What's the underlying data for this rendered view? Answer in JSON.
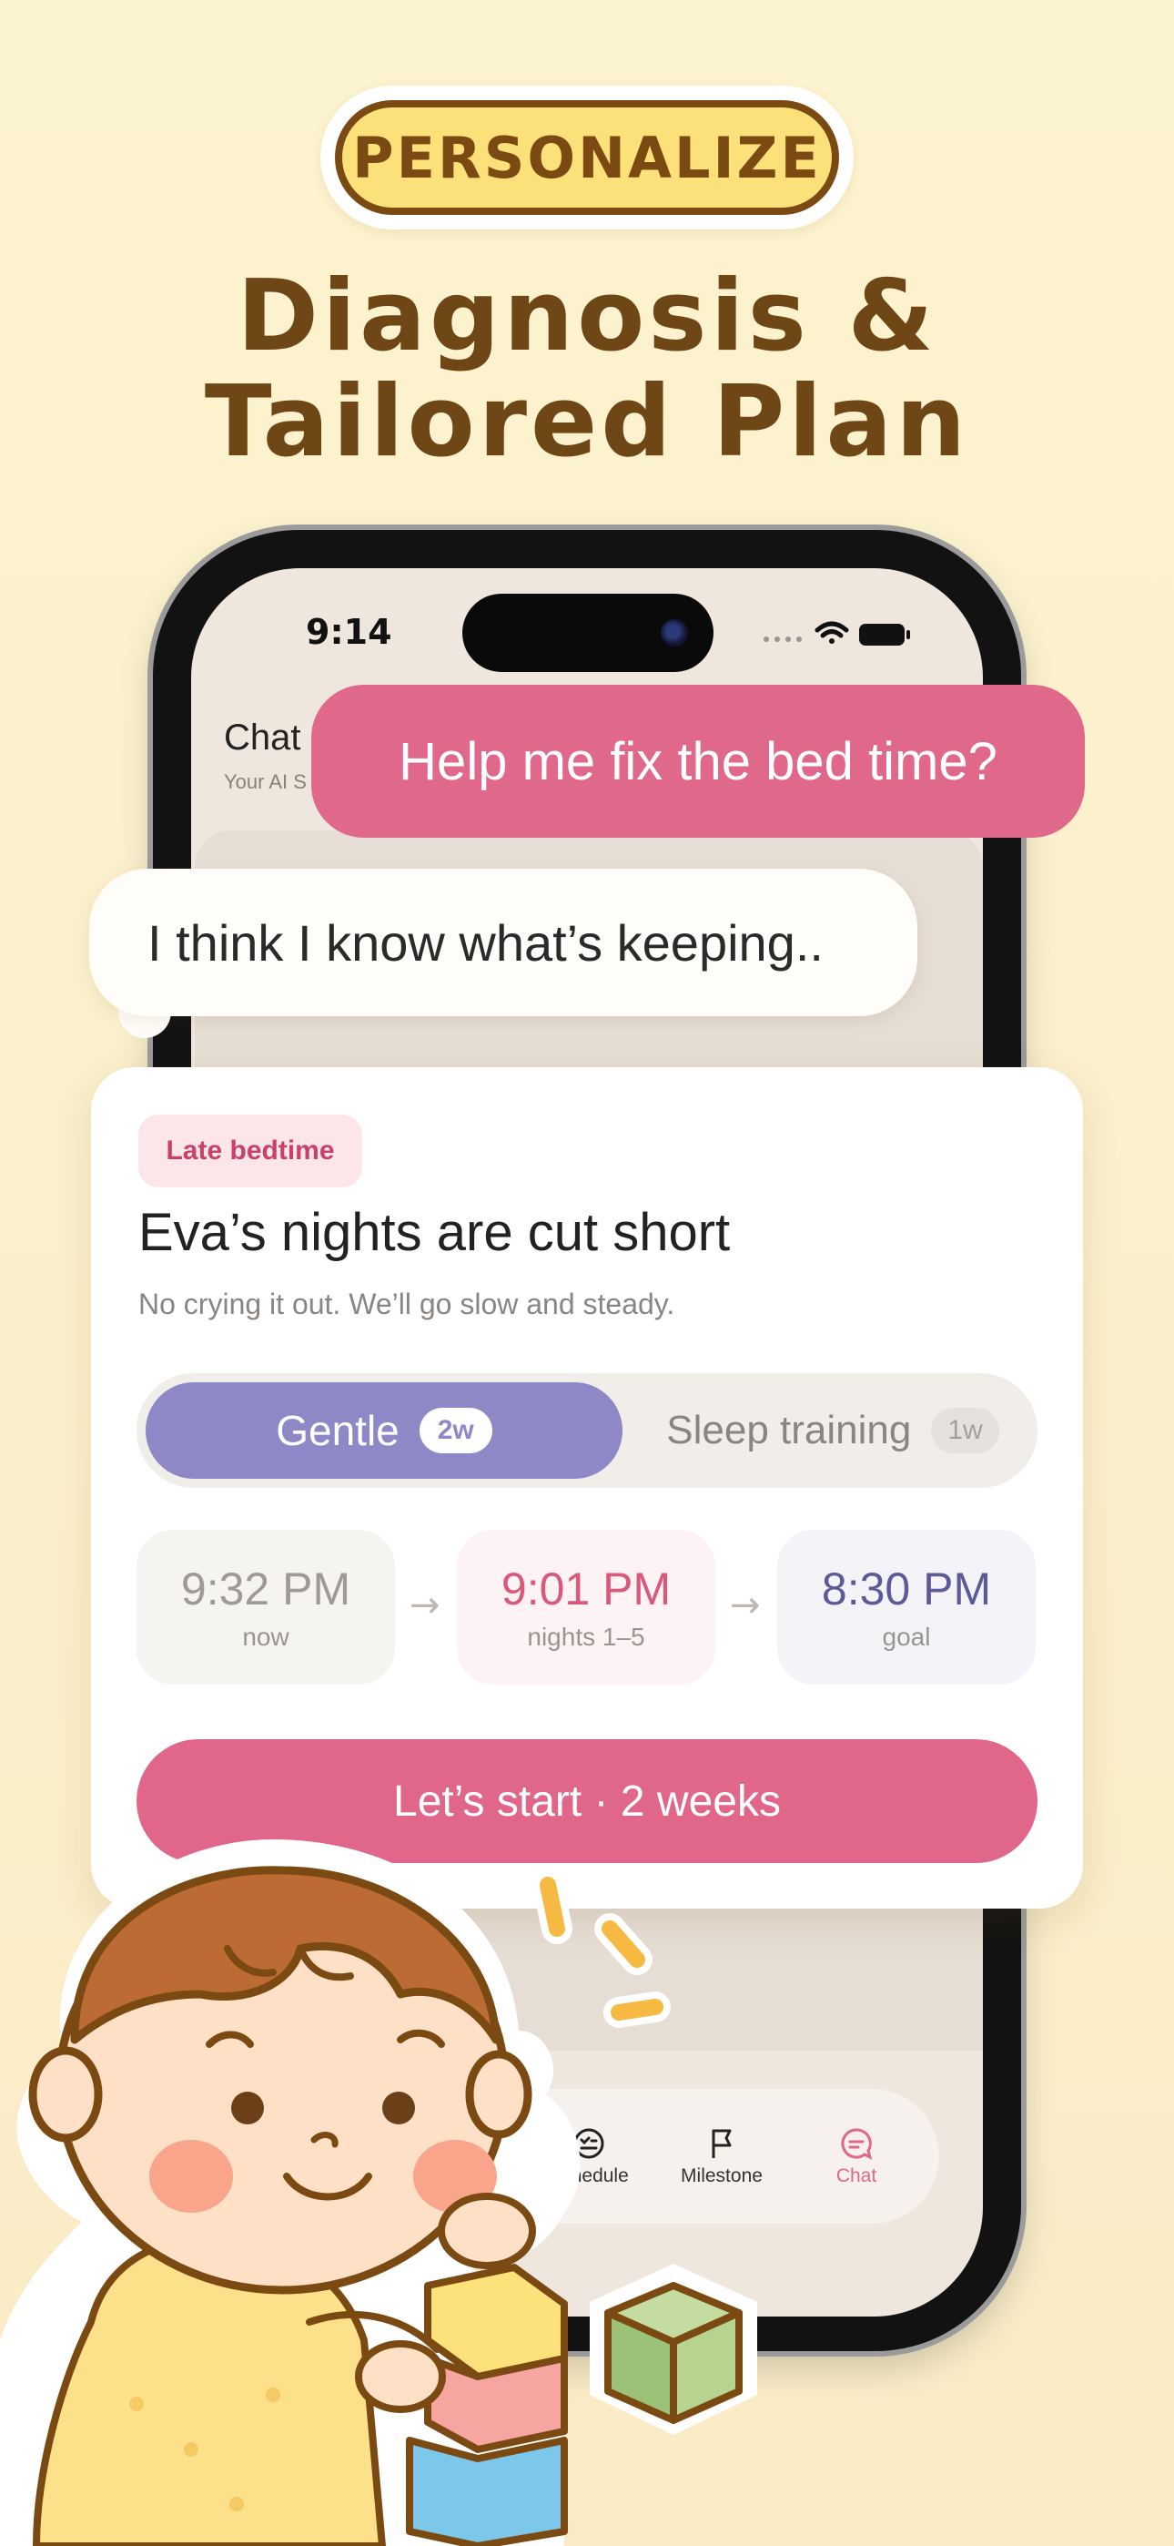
{
  "badge": {
    "label": "PERSONALIZE"
  },
  "headline": {
    "line1": "Diagnosis &",
    "line2": "Tailored Plan"
  },
  "status_bar": {
    "time": "9:14"
  },
  "chat_header": {
    "title": "Chat",
    "subtitle": "Your AI S"
  },
  "messages": {
    "user": "Help me fix the bed time?",
    "ai": "I think I know what’s keeping.."
  },
  "plan_card": {
    "tag": "Late bedtime",
    "title": "Eva’s nights are cut short",
    "subtitle": "No crying it out. We’ll go slow and steady.",
    "modes": [
      {
        "label": "Gentle",
        "duration": "2w",
        "selected": true
      },
      {
        "label": "Sleep training",
        "duration": "1w",
        "selected": false
      }
    ],
    "timeline": [
      {
        "time": "9:32 PM",
        "label": "now"
      },
      {
        "time": "9:01 PM",
        "label": "nights 1–5"
      },
      {
        "time": "8:30 PM",
        "label": "goal"
      }
    ],
    "arrow": "→",
    "cta": "Let’s start · 2 weeks"
  },
  "tab_bar": {
    "items": [
      {
        "label": "Schedule",
        "icon": "schedule-icon"
      },
      {
        "label": "Milestone",
        "icon": "flag-icon"
      },
      {
        "label": "Chat",
        "icon": "chat-icon",
        "active": true
      }
    ]
  },
  "colors": {
    "background": "#fcf3cf",
    "brand_brown": "#7a4a12",
    "accent_pink": "#e0688a",
    "accent_purple": "#8f88c6",
    "badge_yellow": "#fce07a"
  }
}
